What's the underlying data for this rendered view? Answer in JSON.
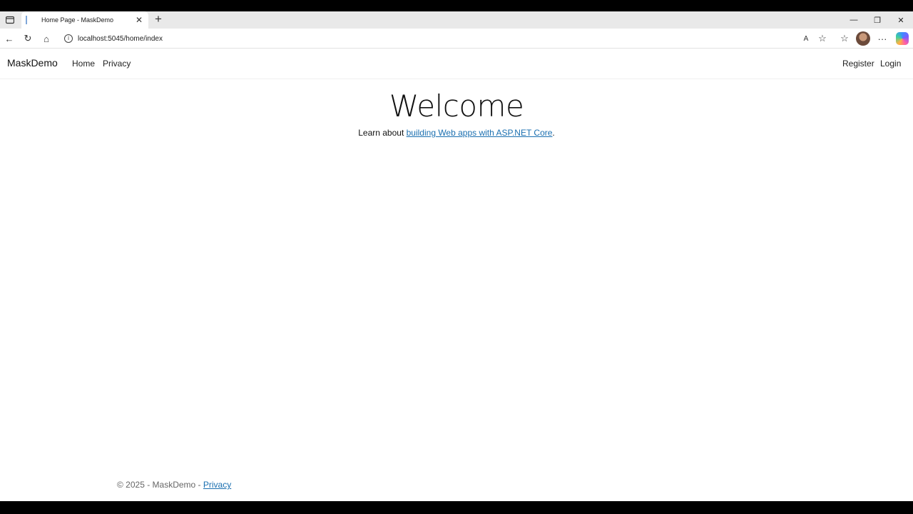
{
  "browser": {
    "tab_title": "Home Page - MaskDemo",
    "tab_close": "✕",
    "new_tab": "+",
    "url": "localhost:5045/home/index",
    "window_controls": {
      "minimize": "—",
      "restore": "❐",
      "close": "✕"
    }
  },
  "toolbar": {
    "back": "←",
    "reload": "↻",
    "home": "⌂",
    "read_aloud": "A",
    "favorite": "☆",
    "favorites": "☆",
    "more": "···"
  },
  "navbar": {
    "brand": "MaskDemo",
    "links": [
      "Home",
      "Privacy"
    ],
    "right_links": [
      "Register",
      "Login"
    ]
  },
  "main": {
    "heading": "Welcome",
    "learn_prefix": "Learn about ",
    "learn_link": "building Web apps with ASP.NET Core",
    "learn_suffix": "."
  },
  "footer": {
    "copyright": "© 2025 - MaskDemo - ",
    "privacy_link": "Privacy"
  },
  "colors": {
    "link": "#1a6fb0",
    "tabstrip": "#e9e9e9"
  }
}
